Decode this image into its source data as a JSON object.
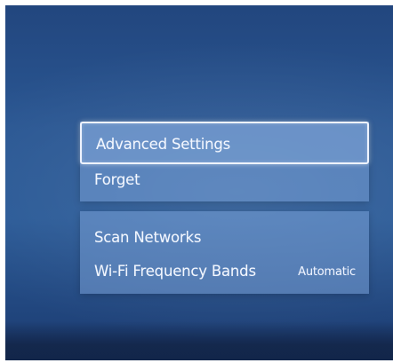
{
  "menu": {
    "group1": {
      "advanced_settings": "Advanced Settings",
      "forget": "Forget"
    },
    "group2": {
      "scan_networks": "Scan Networks",
      "wifi_frequency_bands": {
        "label": "Wi-Fi Frequency Bands",
        "value": "Automatic"
      }
    },
    "selected": "Advanced Settings"
  },
  "colors": {
    "background": "#2a5793",
    "panel": "#6f93c8",
    "text": "#f3f7ff",
    "focus_border": "#eef3ff"
  }
}
